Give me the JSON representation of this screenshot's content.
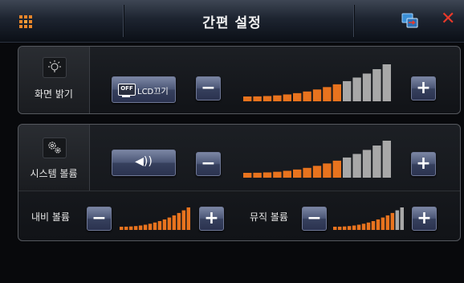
{
  "header": {
    "title": "간편 설정",
    "menu_icon": "grid-menu-icon",
    "screen_icon": "screen-switch-icon",
    "close_icon": "close-icon",
    "close_glyph": "✕"
  },
  "brightness": {
    "label": "화면 밝기",
    "icon": "brightness-icon",
    "lcd_off_badge": "OFF",
    "lcd_off_label": "LCD끄기",
    "minus": "−",
    "plus": "+",
    "level": 10,
    "max": 15
  },
  "system_volume": {
    "label": "시스템 볼륨",
    "icon": "gear-icon",
    "sound_button_icon": "speaker-icon",
    "sound_glyph": "◀))",
    "minus": "−",
    "plus": "+",
    "level": 10,
    "max": 15
  },
  "nav_volume": {
    "label": "내비 볼륨",
    "minus": "−",
    "plus": "+",
    "level": 15,
    "max": 15
  },
  "music_volume": {
    "label": "뮤직 볼륨",
    "minus": "−",
    "plus": "+",
    "level": 13,
    "max": 15
  },
  "colors": {
    "active_bar": "#e8731e",
    "inactive_bar": "#a8a8a8",
    "accent": "#e8862a",
    "close": "#e8392a"
  }
}
